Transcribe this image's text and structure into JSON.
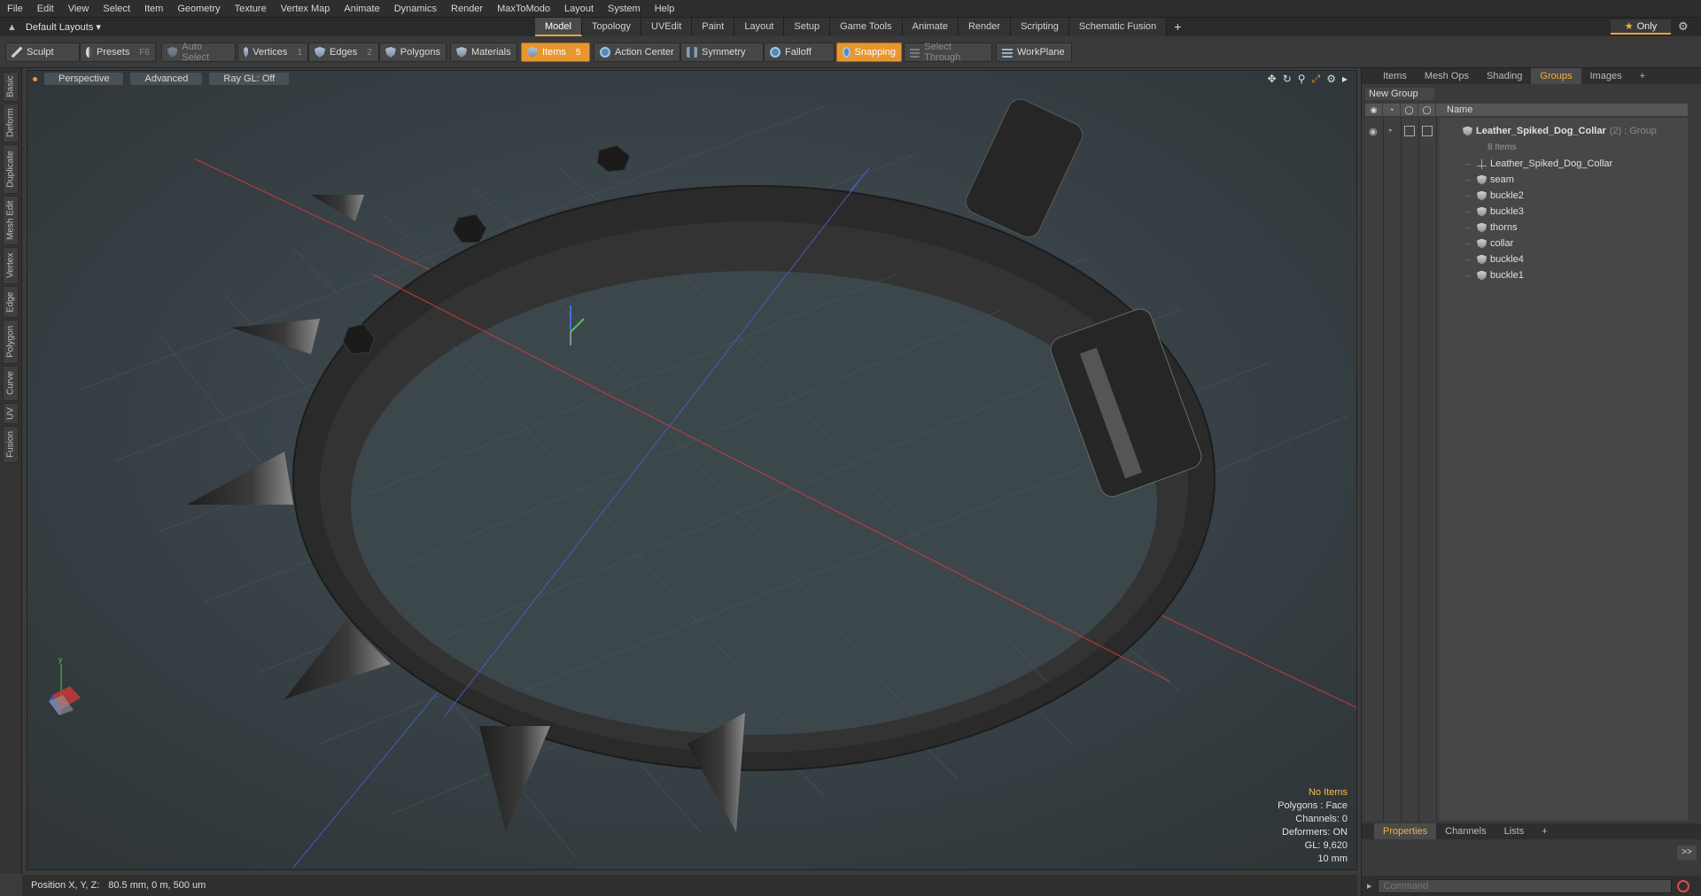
{
  "menu": [
    "File",
    "Edit",
    "View",
    "Select",
    "Item",
    "Geometry",
    "Texture",
    "Vertex Map",
    "Animate",
    "Dynamics",
    "Render",
    "MaxToModo",
    "Layout",
    "System",
    "Help"
  ],
  "layout_switch": {
    "label": "Default Layouts ▾"
  },
  "layout_tabs": [
    "Model",
    "Topology",
    "UVEdit",
    "Paint",
    "Layout",
    "Setup",
    "Game Tools",
    "Animate",
    "Render",
    "Scripting",
    "Schematic Fusion"
  ],
  "active_layout_tab": "Model",
  "add_tab": "+",
  "only_button": {
    "star": "★",
    "label": "Only"
  },
  "toolbar": {
    "sculpt": "Sculpt",
    "presets": "Presets",
    "presets_key": "F6",
    "auto_select": "Auto Select",
    "vertices": "Vertices",
    "vertices_count": "1",
    "edges": "Edges",
    "edges_count": "2",
    "polygons": "Polygons",
    "materials": "Materials",
    "items": "Items",
    "items_count": "5",
    "action_center": "Action Center",
    "symmetry": "Symmetry",
    "falloff": "Falloff",
    "snapping": "Snapping",
    "select_through": "Select Through",
    "workplane": "WorkPlane"
  },
  "left_tabs": [
    "Basic",
    "Deform",
    "Duplicate",
    "Mesh Edit",
    "Vertex",
    "Edge",
    "Polygon",
    "Curve",
    "UV",
    "Fusion"
  ],
  "viewport": {
    "perspective": "Perspective",
    "advanced": "Advanced",
    "raygl": "Ray GL: Off",
    "info": {
      "no_items": "No Items",
      "polygons": "Polygons : Face",
      "channels": "Channels: 0",
      "deformers": "Deformers: ON",
      "gl": "GL: 9,620",
      "scale": "10 mm"
    }
  },
  "statusbar": {
    "label": "Position X, Y, Z:",
    "value": "80.5 mm, 0 m, 500 um"
  },
  "right_panel": {
    "tabs": [
      "Items",
      "Mesh Ops",
      "Shading",
      "Groups",
      "Images"
    ],
    "active_tab": "Groups",
    "new_group": "New Group",
    "name_header": "Name",
    "root": {
      "name": "Leather_Spiked_Dog_Collar",
      "suffix": "(2) : Group",
      "sub": "8 Items"
    },
    "items": [
      "Leather_Spiked_Dog_Collar",
      "seam",
      "buckle2",
      "buckle3",
      "thorns",
      "collar",
      "buckle4",
      "buckle1"
    ],
    "bottom_tabs": [
      "Properties",
      "Channels",
      "Lists"
    ],
    "active_bottom_tab": "Properties",
    "expand": ">>",
    "command_placeholder": "Command"
  },
  "colors": {
    "accent": "#e8962f",
    "active_text": "#f0b23e",
    "viewport_bg": "#3b4347",
    "x_axis": "#c83a3a",
    "z_axis": "#4a5ab8"
  }
}
